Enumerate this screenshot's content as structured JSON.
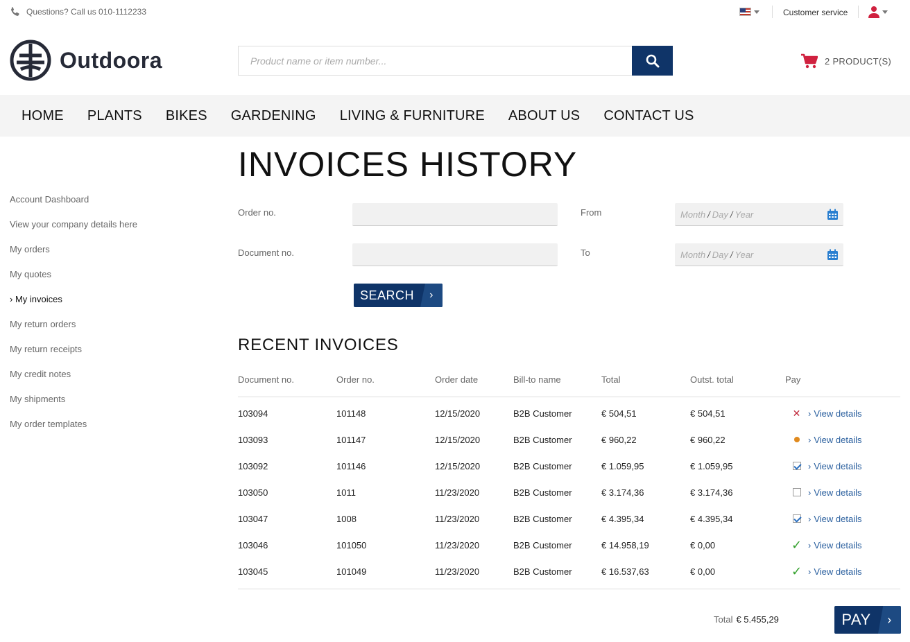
{
  "topbar": {
    "phone_text": "Questions? Call us 010-1112233",
    "customer_service": "Customer service"
  },
  "header": {
    "logo_text": "Outdoora",
    "search_placeholder": "Product name or item number...",
    "cart_label": "2 PRODUCT(S)"
  },
  "nav": [
    "HOME",
    "PLANTS",
    "BIKES",
    "GARDENING",
    "LIVING & FURNITURE",
    "ABOUT US",
    "CONTACT US"
  ],
  "page_title": "INVOICES HISTORY",
  "sidebar": [
    {
      "label": "Account Dashboard",
      "active": false
    },
    {
      "label": "View your company details here",
      "active": false
    },
    {
      "label": "My orders",
      "active": false
    },
    {
      "label": "My quotes",
      "active": false
    },
    {
      "label": "My invoices",
      "active": true
    },
    {
      "label": "My return orders",
      "active": false
    },
    {
      "label": "My return receipts",
      "active": false
    },
    {
      "label": "My credit notes",
      "active": false
    },
    {
      "label": "My shipments",
      "active": false
    },
    {
      "label": "My order templates",
      "active": false
    }
  ],
  "filters": {
    "order_no_label": "Order no.",
    "document_no_label": "Document no.",
    "from_label": "From",
    "to_label": "To",
    "date_month": "Month",
    "date_day": "Day",
    "date_year": "Year",
    "search_button": "SEARCH"
  },
  "recent_title": "RECENT INVOICES",
  "table": {
    "headers": [
      "Document no.",
      "Order no.",
      "Order date",
      "Bill-to name",
      "Total",
      "Outst. total",
      "Pay"
    ],
    "link_label": "View details",
    "rows": [
      {
        "doc": "103094",
        "order": "101148",
        "date": "12/15/2020",
        "bill_to": "B2B Customer",
        "total": "€ 504,51",
        "outst": "€ 504,51",
        "pay": "error"
      },
      {
        "doc": "103093",
        "order": "101147",
        "date": "12/15/2020",
        "bill_to": "B2B Customer",
        "total": "€ 960,22",
        "outst": "€ 960,22",
        "pay": "pending"
      },
      {
        "doc": "103092",
        "order": "101146",
        "date": "12/15/2020",
        "bill_to": "B2B Customer",
        "total": "€ 1.059,95",
        "outst": "€ 1.059,95",
        "pay": "checked"
      },
      {
        "doc": "103050",
        "order": "1011",
        "date": "11/23/2020",
        "bill_to": "B2B Customer",
        "total": "€ 3.174,36",
        "outst": "€ 3.174,36",
        "pay": "unchecked"
      },
      {
        "doc": "103047",
        "order": "1008",
        "date": "11/23/2020",
        "bill_to": "B2B Customer",
        "total": "€ 4.395,34",
        "outst": "€ 4.395,34",
        "pay": "checked"
      },
      {
        "doc": "103046",
        "order": "101050",
        "date": "11/23/2020",
        "bill_to": "B2B Customer",
        "total": "€ 14.958,19",
        "outst": "€ 0,00",
        "pay": "paid"
      },
      {
        "doc": "103045",
        "order": "101049",
        "date": "11/23/2020",
        "bill_to": "B2B Customer",
        "total": "€ 16.537,63",
        "outst": "€ 0,00",
        "pay": "paid"
      }
    ]
  },
  "footer": {
    "total_label": "Total",
    "total_value": "€ 5.455,29",
    "pay_button": "PAY"
  },
  "colors": {
    "primary": "#0f3468",
    "cart_icon": "#d0213f",
    "link": "#2a5f9e",
    "nav_bg": "#f4f4f4"
  },
  "icons": {
    "phone": "phone-icon",
    "search": "search-icon",
    "cart": "cart-icon",
    "calendar": "calendar-icon",
    "user": "user-icon",
    "flag": "us-flag-icon"
  }
}
